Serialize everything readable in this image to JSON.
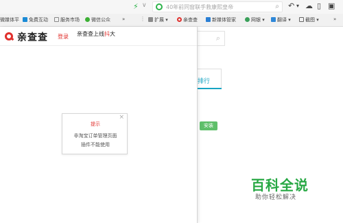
{
  "toolbar": {
    "address_text": "40年前同窗联手救康熙皇帝",
    "colors": {
      "accent_green": "#2db34a"
    }
  },
  "bookmarks": [
    {
      "label": "微媒体平"
    },
    {
      "label": "免费互动"
    },
    {
      "label": "服务市场"
    },
    {
      "label": "微信公众"
    },
    {
      "label": "»"
    },
    {
      "label": "扩展"
    },
    {
      "label": "亲查查"
    },
    {
      "label": "新媒体管家"
    },
    {
      "label": "网银"
    },
    {
      "label": "翻译"
    },
    {
      "label": "截图"
    },
    {
      "label": "»"
    }
  ],
  "page": {
    "rank_tab_label": "排行",
    "install_label": "安装"
  },
  "popup": {
    "brand": "亲查查",
    "login_label": "登录",
    "promo_prefix": "亲查查上线",
    "promo_highlight": "抖",
    "promo_suffix": "大",
    "dialog": {
      "title": "提示",
      "line1": "非淘宝订单管理页面",
      "line2": "插件不能使用",
      "close_glyph": "×"
    }
  },
  "watermark": {
    "title": "百科全说",
    "subtitle": "助你轻松解决"
  }
}
